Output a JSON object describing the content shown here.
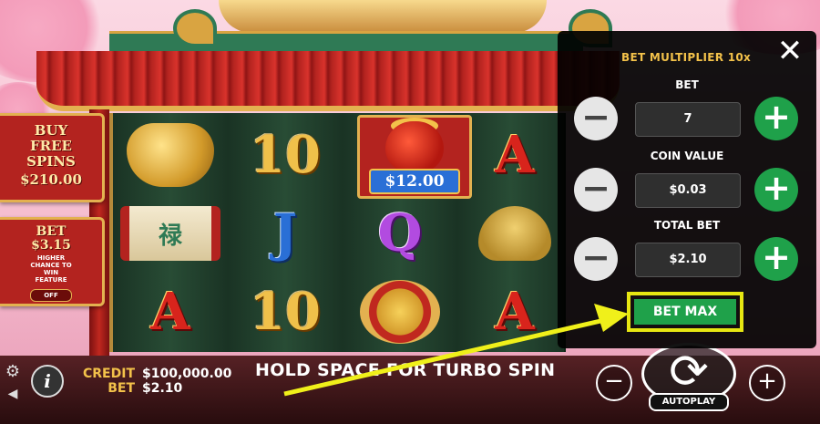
{
  "side": {
    "buy_free_spins": {
      "title": "BUY FREE SPINS",
      "price": "$210.00"
    },
    "ante_bet": {
      "title": "BET",
      "amount": "$3.15",
      "description": "HIGHER CHANCE TO WIN FEATURE",
      "toggle": "OFF"
    }
  },
  "reels": {
    "symbols": [
      [
        "gold-pot",
        "scroll",
        "A"
      ],
      [
        "10",
        "J",
        "10"
      ],
      [
        "money-bag",
        "Q",
        "coins"
      ],
      [
        "A",
        "frog",
        "A"
      ]
    ],
    "money_bag_value": "$12.00",
    "scroll_glyph": "禄"
  },
  "bottom": {
    "credit_label": "CREDIT",
    "credit_value": "$100,000.00",
    "bet_label": "BET",
    "bet_value": "$2.10",
    "message": "HOLD SPACE FOR TURBO SPIN",
    "autoplay_label": "AUTOPLAY"
  },
  "panel": {
    "title": "BET MULTIPLIER 10x",
    "rows": [
      {
        "label": "BET",
        "value": "7"
      },
      {
        "label": "COIN VALUE",
        "value": "$0.03"
      },
      {
        "label": "TOTAL BET",
        "value": "$2.10"
      }
    ],
    "bet_max_label": "BET MAX"
  },
  "colors": {
    "highlight": "#e6e612",
    "plus_button": "#1fa14a",
    "gold": "#f3c24a",
    "roof_red": "#b3231f"
  },
  "icons": {
    "close": "close-icon",
    "settings": "gear-icon",
    "sound": "speaker-icon",
    "info": "info-icon",
    "spin": "spin-arrows-icon"
  }
}
